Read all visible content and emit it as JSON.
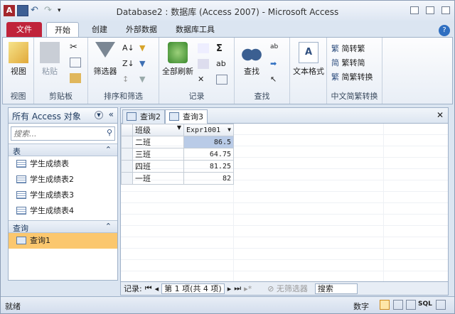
{
  "window": {
    "title": "Database2 : 数据库 (Access 2007) - Microsoft Access"
  },
  "tabs": [
    "文件",
    "开始",
    "创建",
    "外部数据",
    "数据库工具"
  ],
  "ribbon": {
    "groups": {
      "view": "视图",
      "clipboard": "剪贴板",
      "sort_filter": "排序和筛选",
      "records": "记录",
      "find": "查找",
      "text_format": "",
      "chinese": "中文简繁转换"
    },
    "buttons": {
      "view": "视图",
      "paste": "粘贴",
      "filter": "筛选器",
      "refresh_all": "全部刷新",
      "find": "查找",
      "text_format": "文本格式",
      "sim_to_trad": "简转繁",
      "trad_to_sim": "繁转简",
      "convert": "简繁转换"
    }
  },
  "nav": {
    "title": "所有 Access 对象",
    "search_placeholder": "搜索...",
    "sections": [
      {
        "label": "表",
        "items": [
          "学生成绩表",
          "学生成绩表2",
          "学生成绩表3",
          "学生成绩表4"
        ]
      },
      {
        "label": "查询",
        "items": [
          "查询1"
        ]
      }
    ]
  },
  "doc_tabs": [
    "查询2",
    "查询3"
  ],
  "datasheet": {
    "columns": [
      "班级",
      "Expr1001"
    ],
    "rows": [
      [
        "二班",
        "86.5"
      ],
      [
        "三班",
        "64.75"
      ],
      [
        "四班",
        "81.25"
      ],
      [
        "一班",
        "82"
      ]
    ]
  },
  "record_nav": {
    "label": "记录:",
    "position": "第 1 项(共 4 项)",
    "filter": "无筛选器",
    "search": "搜索"
  },
  "status": {
    "left": "就绪",
    "right": "数字"
  }
}
